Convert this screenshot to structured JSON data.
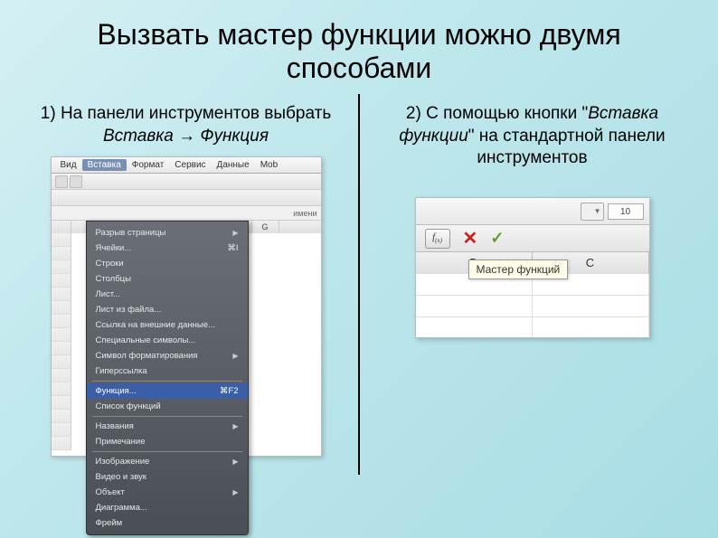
{
  "title": "Вызвать мастер функции можно двумя способами",
  "left": {
    "text1": "1) На панели инструментов выбрать ",
    "text2": "Вставка → Функция",
    "menubar": [
      "Вид",
      "Вставка",
      "Формат",
      "Сервис",
      "Данные",
      "Mob"
    ],
    "activeMenu": "Вставка",
    "nameboxHint": "имени",
    "dropdown": {
      "g1": [
        "Разрыв страницы",
        "Ячейки...",
        "Строки",
        "Столбцы",
        "Лист...",
        "Лист из файла...",
        "Ссылка на внешние данные...",
        "Специальные символы...",
        "Символ форматирования",
        "Гиперссылка"
      ],
      "cellsShortcut": "⌘I",
      "g2": [
        "Функция...",
        "Список функций"
      ],
      "funcShortcut": "⌘F2",
      "g3": [
        "Названия",
        "Примечание"
      ],
      "g4": [
        "Изображение",
        "Видео и звук",
        "Объект",
        "Диаграмма...",
        "Фрейм"
      ]
    },
    "colG": "G"
  },
  "right": {
    "text1": "2) С помощью кнопки \"",
    "text2": "Вставка функции",
    "text3": "\" на стандартной панели инструментов",
    "cellRef": "10",
    "fxLabel": "f(x)",
    "cols": [
      "B",
      "C"
    ],
    "tooltip": "Мастер функций"
  }
}
